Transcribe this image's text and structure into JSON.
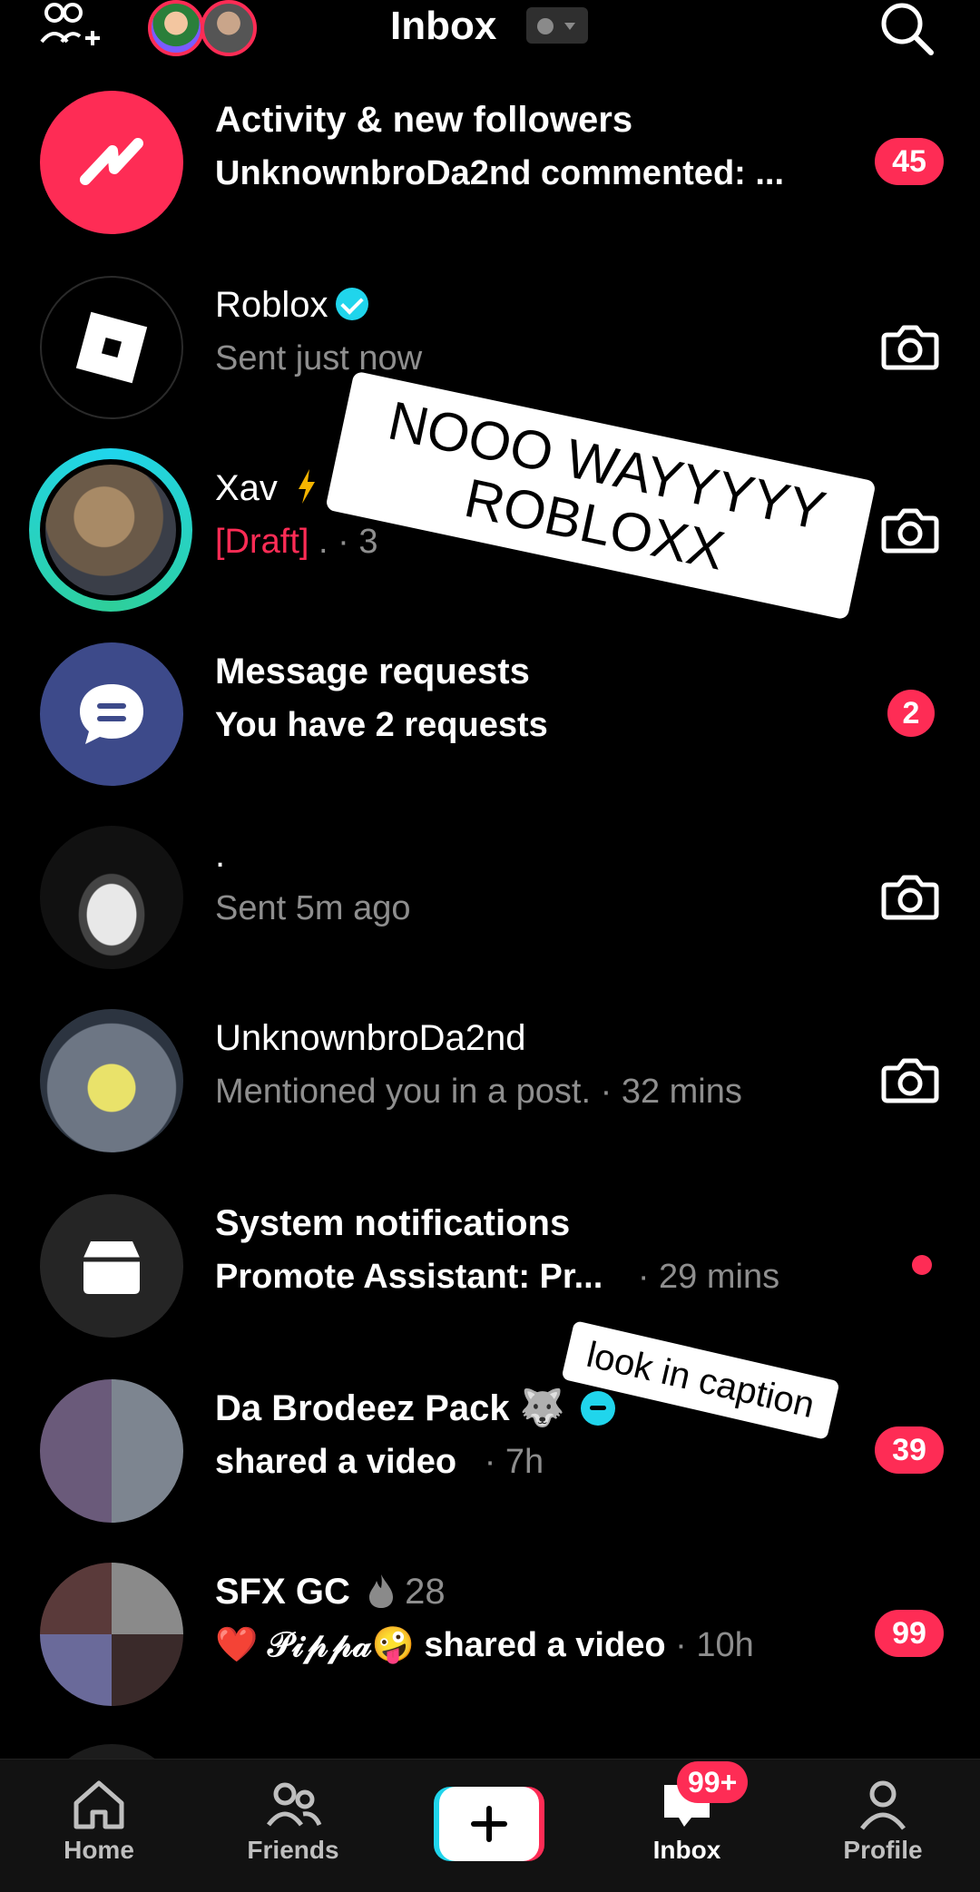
{
  "header": {
    "title": "Inbox"
  },
  "rows": [
    {
      "title": "Activity & new followers",
      "subtitle": "UnknownbroDa2nd commented: ...",
      "badge": "45"
    },
    {
      "title": "Roblox",
      "subtitle": "Sent just now"
    },
    {
      "title": "Xav",
      "draft": "[Draft]",
      "subtitle": " . · 3"
    },
    {
      "title": "Message requests",
      "subtitle": "You have 2 requests",
      "badge": "2"
    },
    {
      "title": ".",
      "subtitle": "Sent 5m ago"
    },
    {
      "title": "UnknownbroDa2nd",
      "subtitle": "Mentioned you in a post. · 32 mins"
    },
    {
      "title": "System notifications",
      "subtitle": "Promote Assistant: Pr...",
      "time": "· 29 mins"
    },
    {
      "title": "Da Brodeez Pack 🐺",
      "subtitle": "shared a video",
      "time": "· 7h",
      "badge": "39"
    },
    {
      "title": "SFX GC",
      "streak": "28",
      "subtitle": "❤️ 𝒫𝒾𝓅𝓅𝒶🤪 shared a video",
      "time": "· 10h",
      "badge": "99"
    }
  ],
  "overlays": {
    "main_text": "NOOO WAYYYYY ROBLOXX",
    "caption_text": "look in caption"
  },
  "nav": {
    "home": "Home",
    "friends": "Friends",
    "inbox": "Inbox",
    "inbox_badge": "99+",
    "profile": "Profile"
  },
  "colors": {
    "accent": "#fe2c55",
    "cyan": "#20d5ec",
    "messages_bg": "#3d4a8a",
    "activity_bg": "#fe2c55"
  }
}
